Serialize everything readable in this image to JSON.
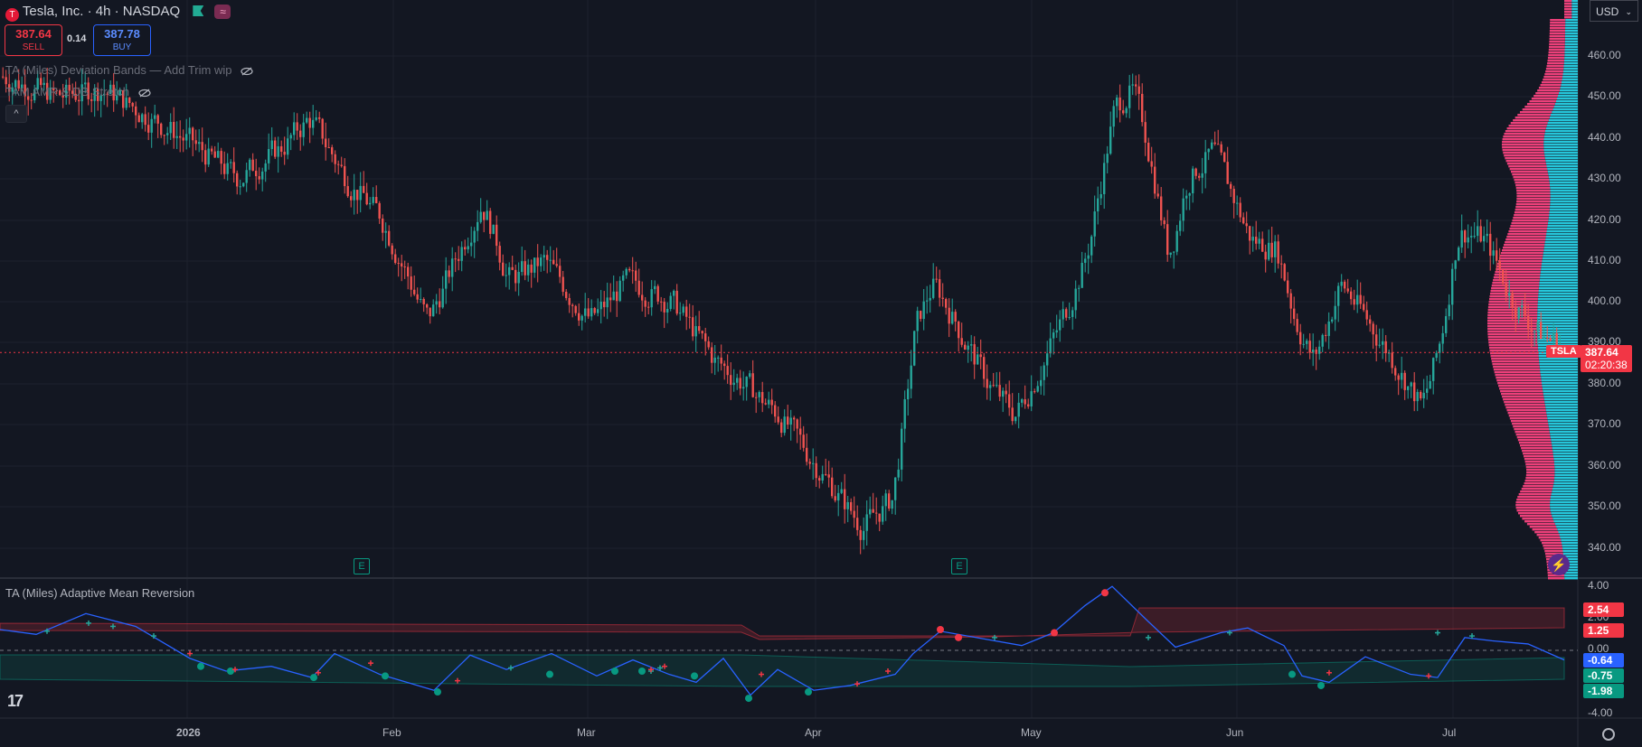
{
  "header": {
    "symbol_title": "Tesla, Inc. · 4h · NASDAQ",
    "sell_price": "387.64",
    "sell_label": "SELL",
    "spread": "0.14",
    "buy_price": "387.78",
    "buy_label": "BUY",
    "indicator_1": "TA (Miles) Deviation Bands — Add Trim wip",
    "indicator_2": "TAM AMR & DB Stretch",
    "currency": "USD"
  },
  "price_axis": {
    "labels": [
      "460.00",
      "450.00",
      "440.00",
      "430.00",
      "420.00",
      "410.00",
      "400.00",
      "390.00",
      "380.00",
      "370.00",
      "360.00",
      "350.00",
      "340.00"
    ],
    "last_price_symbol": "TSLA",
    "last_price": "387.64",
    "countdown": "02:20:38"
  },
  "indicator_pane": {
    "title": "TA (Miles) Adaptive Mean Reversion",
    "axis_labels": [
      "4.00",
      "2.00",
      "0.00",
      "-4.00"
    ],
    "value_tags": [
      {
        "text": "2.54",
        "color": "#f23645"
      },
      {
        "text": "1.25",
        "color": "#f23645"
      },
      {
        "text": "-0.64",
        "color": "#2962ff"
      },
      {
        "text": "-0.75",
        "color": "#089981"
      },
      {
        "text": "-1.98",
        "color": "#089981"
      }
    ]
  },
  "time_axis": {
    "labels": [
      "2026",
      "Feb",
      "Mar",
      "Apr",
      "May",
      "Jun",
      "Jul"
    ]
  },
  "earnings_markers": [
    "E",
    "E"
  ],
  "colors": {
    "background": "#131722",
    "up": "#26a69a",
    "down": "#ef5350",
    "volume_profile_up": "#26c6da",
    "volume_profile_down": "#ec407a",
    "oscillator_line": "#2962ff"
  },
  "icons": [
    "tesla-logo-icon",
    "flag-icon",
    "wave-icon",
    "eye-off-icon",
    "collapse-icon",
    "tradingview-logo-icon",
    "settings-icon",
    "bolt-icon"
  ]
}
